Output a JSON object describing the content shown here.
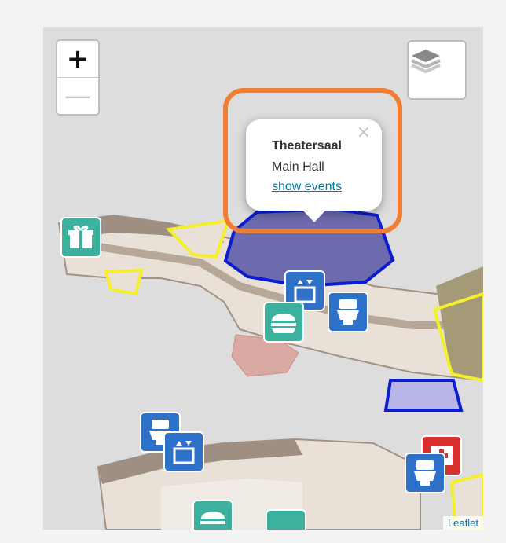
{
  "controls": {
    "zoom_in": "+",
    "zoom_out": "—"
  },
  "layers_icon": "layers-icon",
  "popup": {
    "close": "×",
    "title": "Theatersaal",
    "subtitle": "Main Hall",
    "link": "show events"
  },
  "attribution": "Leaflet",
  "colors": {
    "background": "#dddddd",
    "floor": "#e9e1d7",
    "walls": "#9f8f82",
    "highlight_room": "#6d6aad",
    "room_outline_blue": "#0a1ed0",
    "room_outline_yellow": "#f5ef2b",
    "callout": "#ef7d33"
  },
  "markers": [
    "gift-icon",
    "elevator-icon",
    "toilet-icon",
    "food-icon",
    "toilet-icon",
    "elevator-icon",
    "first-aid-icon",
    "toilet-icon",
    "food-icon"
  ]
}
